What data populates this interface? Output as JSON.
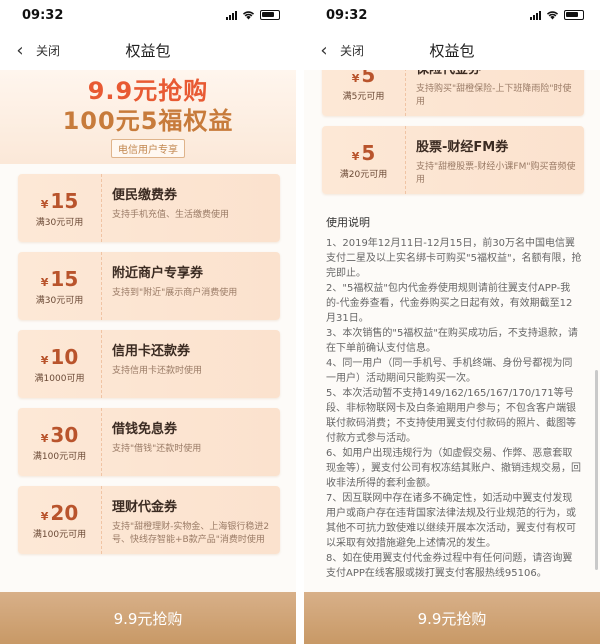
{
  "status": {
    "time": "09:32"
  },
  "nav": {
    "back_icon": "‹",
    "close_label": "关闭",
    "title": "权益包"
  },
  "hero": {
    "line1": "9.9元抢购",
    "line2": "100元5福权益",
    "tag": "电信用户专享"
  },
  "coupons": [
    {
      "currency": "¥",
      "amount": "15",
      "condition": "满30元可用",
      "name": "便民缴费券",
      "desc": "支持手机充值、生活缴费使用"
    },
    {
      "currency": "¥",
      "amount": "15",
      "condition": "满30元可用",
      "name": "附近商户专享券",
      "desc": "支持到\"附近\"展示商户消费使用"
    },
    {
      "currency": "¥",
      "amount": "10",
      "condition": "满1000可用",
      "name": "信用卡还款券",
      "desc": "支持信用卡还款时使用"
    },
    {
      "currency": "¥",
      "amount": "30",
      "condition": "满100元可用",
      "name": "借钱免息券",
      "desc": "支持\"借钱\"还款时使用"
    },
    {
      "currency": "¥",
      "amount": "20",
      "condition": "满100元可用",
      "name": "理财代金券",
      "desc": "支持\"甜橙理财-实物金、上海银行稳进2号、快线存智能+B款产品\"消费时使用"
    }
  ],
  "right_coupons": [
    {
      "currency": "¥",
      "amount": "5",
      "condition": "满5元可用",
      "name": "保险代金券",
      "desc": "支持购买\"甜橙保险-上下班降雨险\"时使用"
    },
    {
      "currency": "¥",
      "amount": "5",
      "condition": "满20元可用",
      "name": "股票-财经FM券",
      "desc": "支持\"甜橙股票-财经小课FM\"购买音频使用"
    }
  ],
  "usage": {
    "title": "使用说明",
    "items": [
      "1、2019年12月11日-12月15日，前30万名中国电信翼支付二星及以上实名绑卡可购买\"5福权益\"，名额有限，抢完即止。",
      "2、\"5福权益\"包内代金券使用规则请前往翼支付APP-我的-代金券查看，代金券购买之日起有效，有效期截至12月31日。",
      "3、本次销售的\"5福权益\"在购买成功后，不支持退款，请在下单前确认支付信息。",
      "4、同一用户（同一手机号、手机终端、身份号都视为同一用户）活动期间只能购买一次。",
      "5、本次活动暂不支持149/162/165/167/170/171等号段、非标物联网卡及白条逾期用户参与；不包含客户端银联付款码消费；不支持使用翼支付付款码的照片、截图等付款方式参与活动。",
      "6、如用户出现违规行为（如虚假交易、作弊、恶意套取现金等），翼支付公司有权冻结其账户、撤销违规交易，回收非法所得的套利金额。",
      "7、因互联网中存在诸多不确定性，如活动中翼支付发现用户或商户存在违背国家法律法规及行业规范的行为，或其他不可抗力致使难以继续开展本次活动，翼支付有权可以采取有效措施避免上述情况的发生。",
      "8、如在使用翼支付代金券过程中有任何问题，请咨询翼支付APP在线客服或拨打翼支付客服热线95106。"
    ]
  },
  "buy_button": "9.9元抢购"
}
